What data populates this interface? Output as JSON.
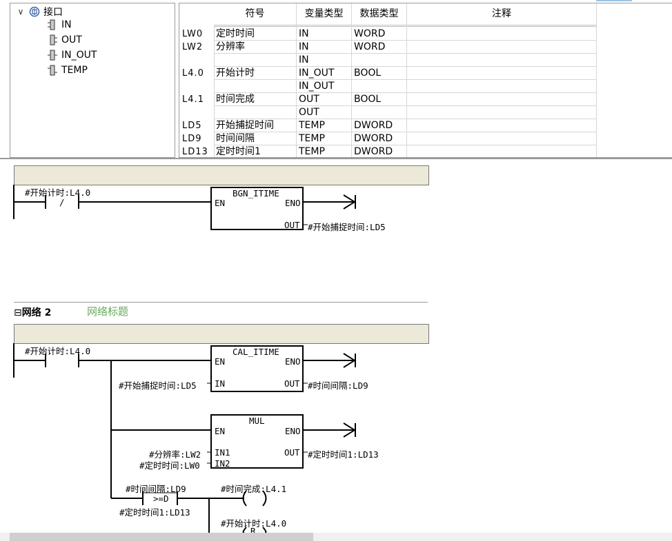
{
  "tree": {
    "root_label": "接口",
    "items": [
      {
        "label": "IN"
      },
      {
        "label": "OUT"
      },
      {
        "label": "IN_OUT"
      },
      {
        "label": "TEMP"
      }
    ]
  },
  "var_table": {
    "headers": {
      "symbol": "符号",
      "var_type": "变量类型",
      "data_type": "数据类型",
      "comment": "注释"
    },
    "rows": [
      {
        "addr": "LW0",
        "symbol": "定时时间",
        "var_type": "IN",
        "data_type": "WORD"
      },
      {
        "addr": "LW2",
        "symbol": "分辨率",
        "var_type": "IN",
        "data_type": "WORD"
      },
      {
        "addr": "",
        "symbol": "",
        "var_type": "IN",
        "data_type": ""
      },
      {
        "addr": "L4.0",
        "symbol": "开始计时",
        "var_type": "IN_OUT",
        "data_type": "BOOL"
      },
      {
        "addr": "",
        "symbol": "",
        "var_type": "IN_OUT",
        "data_type": ""
      },
      {
        "addr": "L4.1",
        "symbol": "时间完成",
        "var_type": "OUT",
        "data_type": "BOOL"
      },
      {
        "addr": "",
        "symbol": "",
        "var_type": "OUT",
        "data_type": ""
      },
      {
        "addr": "LD5",
        "symbol": "开始捕捉时间",
        "var_type": "TEMP",
        "data_type": "DWORD"
      },
      {
        "addr": "LD9",
        "symbol": "时间间隔",
        "var_type": "TEMP",
        "data_type": "DWORD"
      },
      {
        "addr": "LD13",
        "symbol": "定时时间1",
        "var_type": "TEMP",
        "data_type": "DWORD"
      }
    ]
  },
  "network1": {
    "contact_label": "#开始计时:L4.0",
    "contact_symbol": "/",
    "block_name": "BGN_ITIME",
    "en": "EN",
    "eno": "ENO",
    "out_pin": "OUT",
    "out_label": "#开始捕捉时间:LD5"
  },
  "network2": {
    "label": "网络 2",
    "title": "网络标题",
    "contact_label": "#开始计时:L4.0",
    "cal_block": {
      "name": "CAL_ITIME",
      "en": "EN",
      "eno": "ENO",
      "in_pin": "IN",
      "out_pin": "OUT",
      "in_label": "#开始捕捉时间:LD5",
      "out_label": "#时间间隔:LD9"
    },
    "mul_block": {
      "name": "MUL",
      "en": "EN",
      "eno": "ENO",
      "in1_pin": "IN1",
      "in2_pin": "IN2",
      "out_pin": "OUT",
      "in1_label": "#分辨率:LW2",
      "in2_label": "#定时时间:LW0",
      "out_label": "#定时时间1:LD13"
    },
    "compare": {
      "top_label": "#时间间隔:LD9",
      "op": ">=D",
      "bottom_label": "#定时时间1:LD13"
    },
    "coil1_label": "#时间完成:L4.1",
    "coil2_label": "#开始计时:L4.0",
    "coil2_letter": "R"
  }
}
